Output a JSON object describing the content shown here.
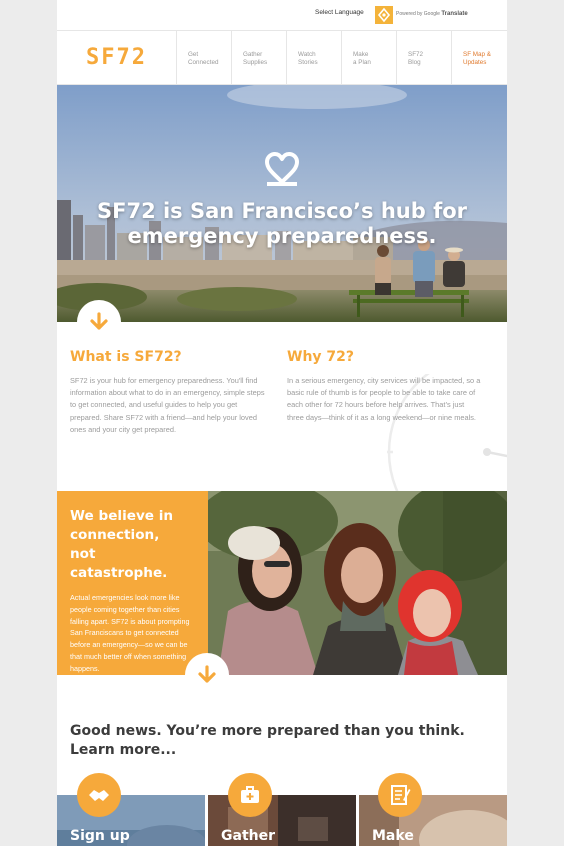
{
  "topbar": {
    "language_label": "Select Language",
    "powered_prefix": "Powered by",
    "powered_brand": "Google",
    "powered_suffix": "Translate"
  },
  "brand": {
    "logo": "SF72",
    "accent": "#f6a93b",
    "link_accent": "#e07a2e"
  },
  "nav": [
    {
      "line1": "Get",
      "line2": "Connected"
    },
    {
      "line1": "Gather",
      "line2": "Supplies"
    },
    {
      "line1": "Watch",
      "line2": "Stories"
    },
    {
      "line1": "Make",
      "line2": "a Plan"
    },
    {
      "line1": "SF72",
      "line2": "Blog"
    },
    {
      "line1": "SF Map &",
      "line2": "Updates"
    }
  ],
  "hero": {
    "title_line1": "SF72 is San Francisco’s hub for",
    "title_line2": "emergency preparedness.",
    "icon": "heart-icon"
  },
  "what": {
    "title": "What is SF72?",
    "body": "SF72 is your hub for emergency preparedness. You'll find information about what to do in an emergency, simple steps to get connected, and useful guides to help you get prepared. Share SF72 with a friend—and help your loved ones and your city get prepared."
  },
  "why": {
    "title": "Why 72?",
    "body": "In a serious emergency, city services will be impacted, so a basic rule of thumb is for people to be able to take care of each other for 72 hours before help arrives. That’s just three days—think of it as a long weekend—or nine meals."
  },
  "believe": {
    "title_line1": "We believe in",
    "title_line2": "connection,",
    "title_line3": "not catastrophe.",
    "body": "Actual emergencies look more like people coming together than cities falling apart. SF72 is about prompting San Franciscans to get connected before an emergency—so we can be that much better off when something happens."
  },
  "good_news": {
    "line1": "Good news. You’re more prepared than you think.",
    "line2": "Learn more..."
  },
  "cards": [
    {
      "label": "Sign up",
      "icon": "handshake-icon"
    },
    {
      "label": "Gather",
      "icon": "first-aid-kit-icon"
    },
    {
      "label": "Make",
      "icon": "checklist-icon"
    }
  ]
}
